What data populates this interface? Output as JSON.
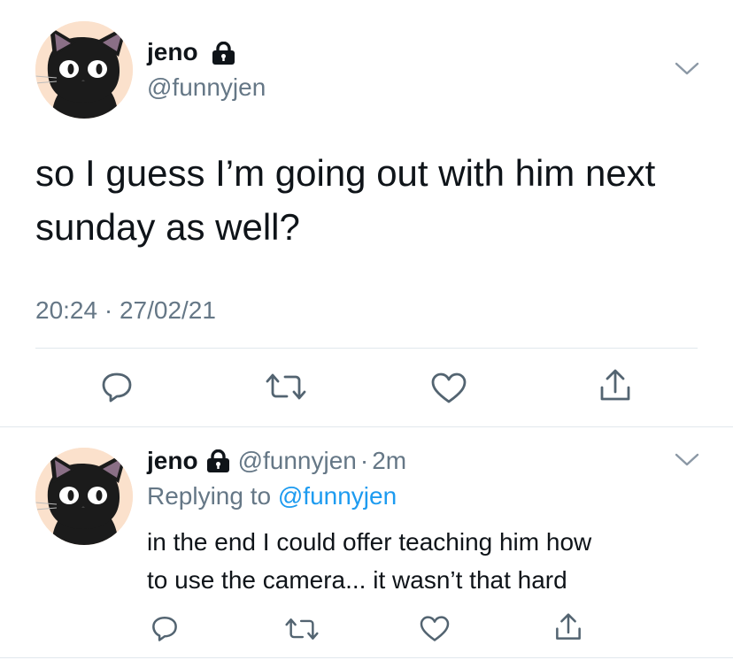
{
  "main_tweet": {
    "display_name": "jeno",
    "handle": "@funnyjen",
    "text_line1": "so I guess I’m going out with him next",
    "text_line2": "sunday as well?",
    "timestamp": "20:24 · 27/02/21",
    "icons": [
      "lock-icon",
      "chevron-down-icon",
      "reply-icon",
      "retweet-icon",
      "like-icon",
      "share-icon"
    ]
  },
  "reply_tweet": {
    "display_name": "jeno",
    "handle": "@funnyjen",
    "separator": "·",
    "time_ago": "2m",
    "replying_prefix": "Replying to",
    "replying_handle": "@funnyjen",
    "text_line1": "in the end I could offer teaching him how",
    "text_line2": "to use the camera... it wasn’t that hard"
  },
  "colors": {
    "text": "#0f1419",
    "muted": "#657786",
    "link": "#1d9bf0",
    "avatar_bg": "#fbe1cc",
    "divider": "#e1e8ed"
  }
}
